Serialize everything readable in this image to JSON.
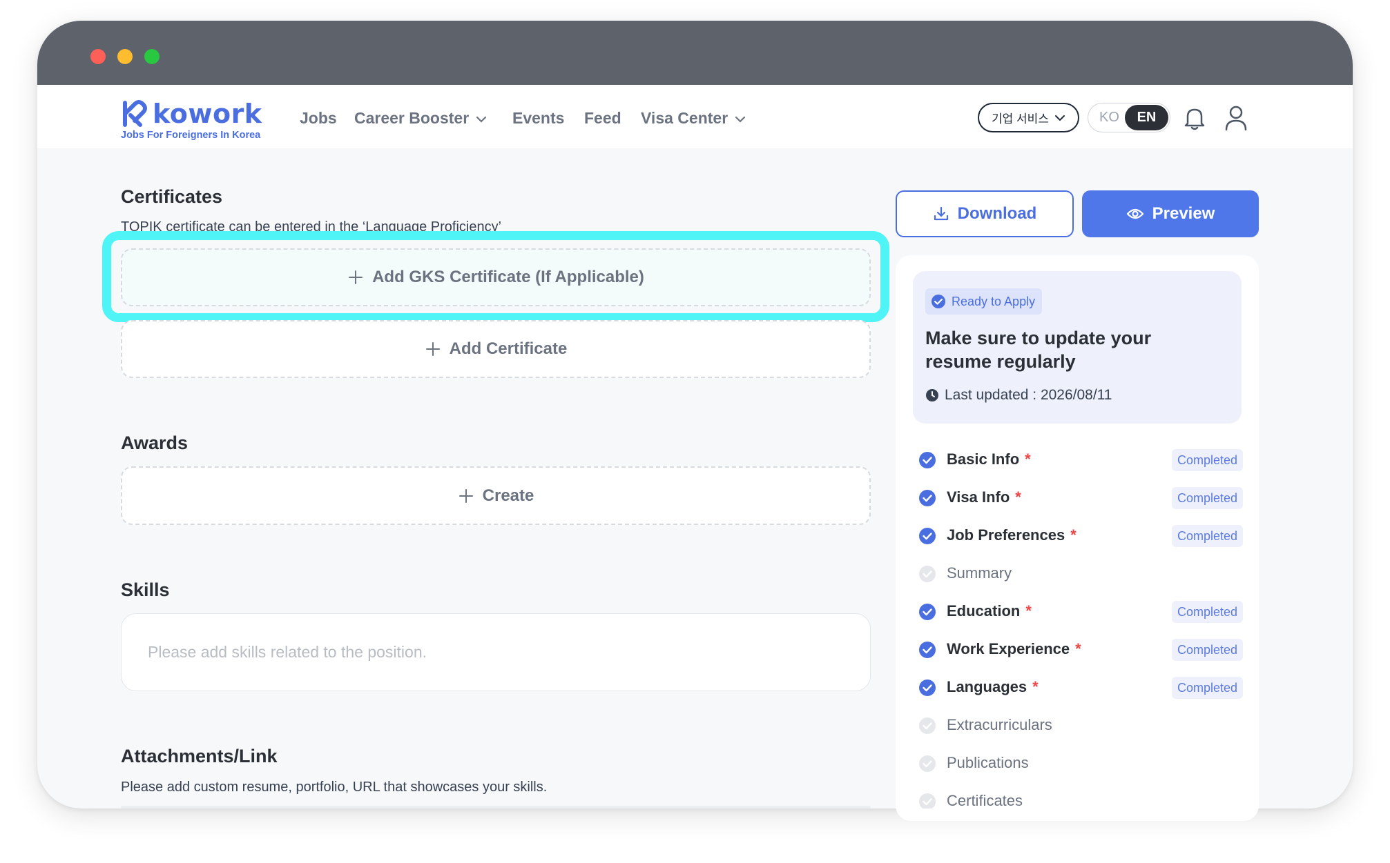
{
  "nav": {
    "logo_text": "kowork",
    "logo_tagline": "Jobs For Foreigners In Korea",
    "items": [
      "Jobs",
      "Career Booster",
      "Events",
      "Feed",
      "Visa Center"
    ],
    "business_button": "기업 서비스",
    "lang_ko": "KO",
    "lang_en": "EN"
  },
  "main": {
    "certificates": {
      "title": "Certificates",
      "subtitle": "TOPIK certificate can be entered in the ‘Language Proficiency’",
      "add_gks": "Add GKS Certificate (If Applicable)",
      "add_certificate": "Add Certificate"
    },
    "awards": {
      "title": "Awards",
      "create": "Create"
    },
    "skills": {
      "title": "Skills",
      "placeholder": "Please add skills related to the position."
    },
    "attachments": {
      "title": "Attachments/Link",
      "subtitle": "Please add custom resume, portfolio, URL that showcases your skills."
    }
  },
  "actions": {
    "download": "Download",
    "preview": "Preview"
  },
  "status": {
    "badge": "Ready to Apply",
    "headline": "Make sure to update your resume regularly",
    "last_updated": "Last updated : 2026/08/11"
  },
  "checklist": [
    {
      "label": "Basic Info",
      "required": "*",
      "status": "Completed"
    },
    {
      "label": "Visa Info",
      "required": "*",
      "status": "Completed"
    },
    {
      "label": "Job Preferences",
      "required": "*",
      "status": "Completed"
    },
    {
      "label": "Summary",
      "required": "",
      "status": ""
    },
    {
      "label": "Education",
      "required": "*",
      "status": "Completed"
    },
    {
      "label": "Work Experience",
      "required": "*",
      "status": "Completed"
    },
    {
      "label": "Languages",
      "required": "*",
      "status": "Completed"
    },
    {
      "label": "Extracurriculars",
      "required": "",
      "status": ""
    },
    {
      "label": "Publications",
      "required": "",
      "status": ""
    },
    {
      "label": "Certificates",
      "required": "",
      "status": ""
    }
  ],
  "colors": {
    "brand": "#4a6ee0",
    "highlight": "#4ff4f6",
    "required": "#ef4444",
    "check_done": "#4a6ee0",
    "check_todo": "#d1d5db"
  }
}
